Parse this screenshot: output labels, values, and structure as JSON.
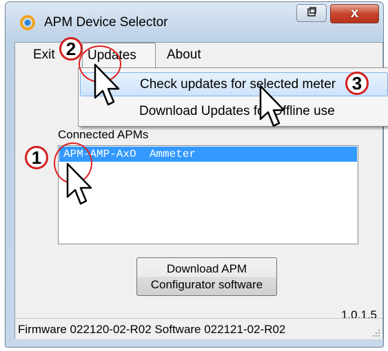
{
  "window": {
    "title": "APM Device Selector",
    "restore_icon": "restore-icon",
    "close_label": "x"
  },
  "menu": {
    "exit_label": "Exit",
    "updates_label": "Updates",
    "about_label": "About"
  },
  "dropdown": {
    "items": [
      {
        "label": "Check updates for selected meter",
        "selected": true
      },
      {
        "label": "Download Updates for Offline use",
        "selected": false
      }
    ]
  },
  "group": {
    "label": "Connected APMs",
    "devices": [
      {
        "label": "APM-AMP-AxO  Ammeter",
        "selected": true
      }
    ]
  },
  "download_button": {
    "line1": "Download APM",
    "line2": "Configurator software"
  },
  "version": "1.0.1.5",
  "status": {
    "text": "Firmware 022120-02-R02  Software 022121-02-R02"
  },
  "annotations": {
    "steps": [
      "1",
      "2",
      "3"
    ],
    "color": "#d41e1e"
  }
}
